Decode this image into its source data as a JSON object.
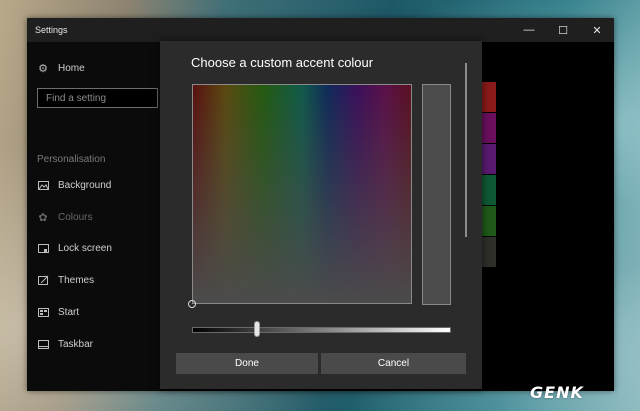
{
  "window": {
    "title": "Settings",
    "controls": {
      "minimize": "—",
      "maximize": "☐",
      "close": "✕"
    }
  },
  "sidebar": {
    "home": {
      "label": "Home",
      "icon": "gear-icon"
    },
    "search": {
      "placeholder": "Find a setting"
    },
    "section_label": "Personalisation",
    "items": [
      {
        "label": "Background",
        "icon": "picture-icon"
      },
      {
        "label": "Colours",
        "icon": "palette-icon",
        "selected": true
      },
      {
        "label": "Lock screen",
        "icon": "lock-screen-icon"
      },
      {
        "label": "Themes",
        "icon": "brush-icon"
      },
      {
        "label": "Start",
        "icon": "start-icon"
      },
      {
        "label": "Taskbar",
        "icon": "taskbar-icon"
      }
    ]
  },
  "swatches": [
    "#8b1a1a",
    "#6b0f5e",
    "#5a1a70",
    "#0f5a35",
    "#1f5a1a",
    "#2f2f2a"
  ],
  "dialog": {
    "title": "Choose a custom accent colour",
    "preview_color": "#4b4b4b",
    "brightness_level": 0.25,
    "done_label": "Done",
    "cancel_label": "Cancel"
  },
  "watermark": "GENK"
}
